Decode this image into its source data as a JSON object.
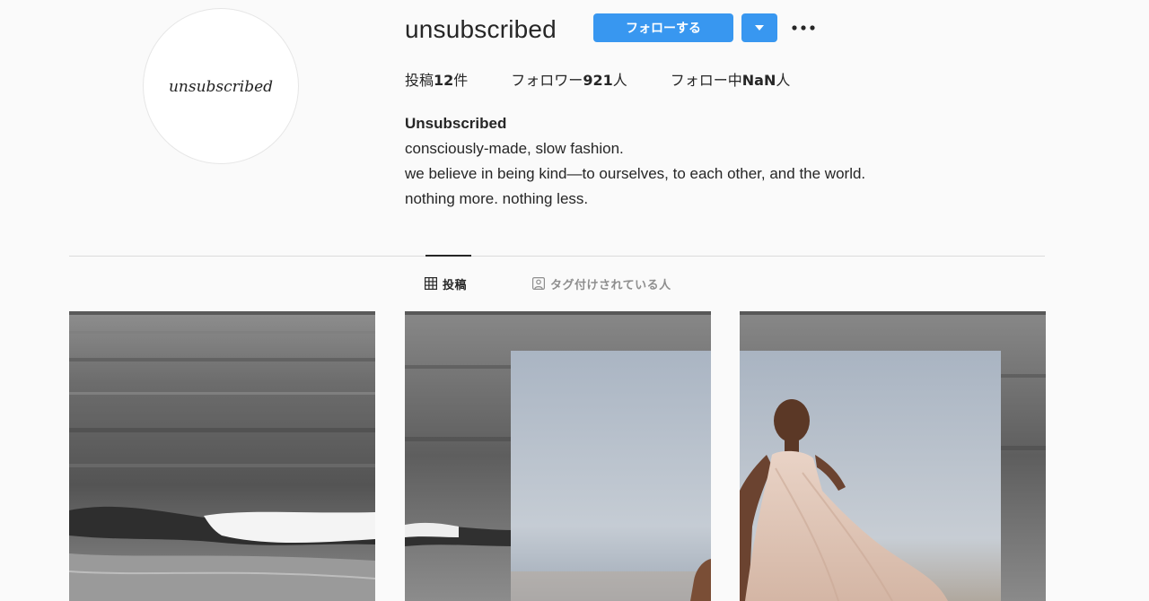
{
  "profile": {
    "username": "unsubscribed",
    "avatar_text": "unsubscribed",
    "follow_button_label": "フォローする",
    "stats": [
      {
        "prefix": "投稿",
        "value": "12",
        "suffix": "件"
      },
      {
        "prefix": "フォロワー",
        "value": "921",
        "suffix": "人"
      },
      {
        "prefix": "フォロー中",
        "value": "NaN",
        "suffix": "人"
      }
    ],
    "bio": {
      "name": "Unsubscribed",
      "lines": [
        "consciously-made, slow fashion.",
        "we believe in being kind—to ourselves, to each other, and the world.",
        "nothing more. nothing less."
      ]
    }
  },
  "tabs": [
    {
      "label": "投稿",
      "icon": "grid-icon",
      "active": true
    },
    {
      "label": "タグ付けされている人",
      "icon": "tagged-person-icon",
      "active": false
    }
  ],
  "posts": [
    {
      "image": "ocean-waves-bw"
    },
    {
      "image": "ocean-with-sky-panel"
    },
    {
      "image": "model-in-dress-on-beach"
    }
  ],
  "colors": {
    "accent": "#3897f0",
    "background": "#fafafa",
    "text": "#262626",
    "muted": "#8e8e8e"
  }
}
